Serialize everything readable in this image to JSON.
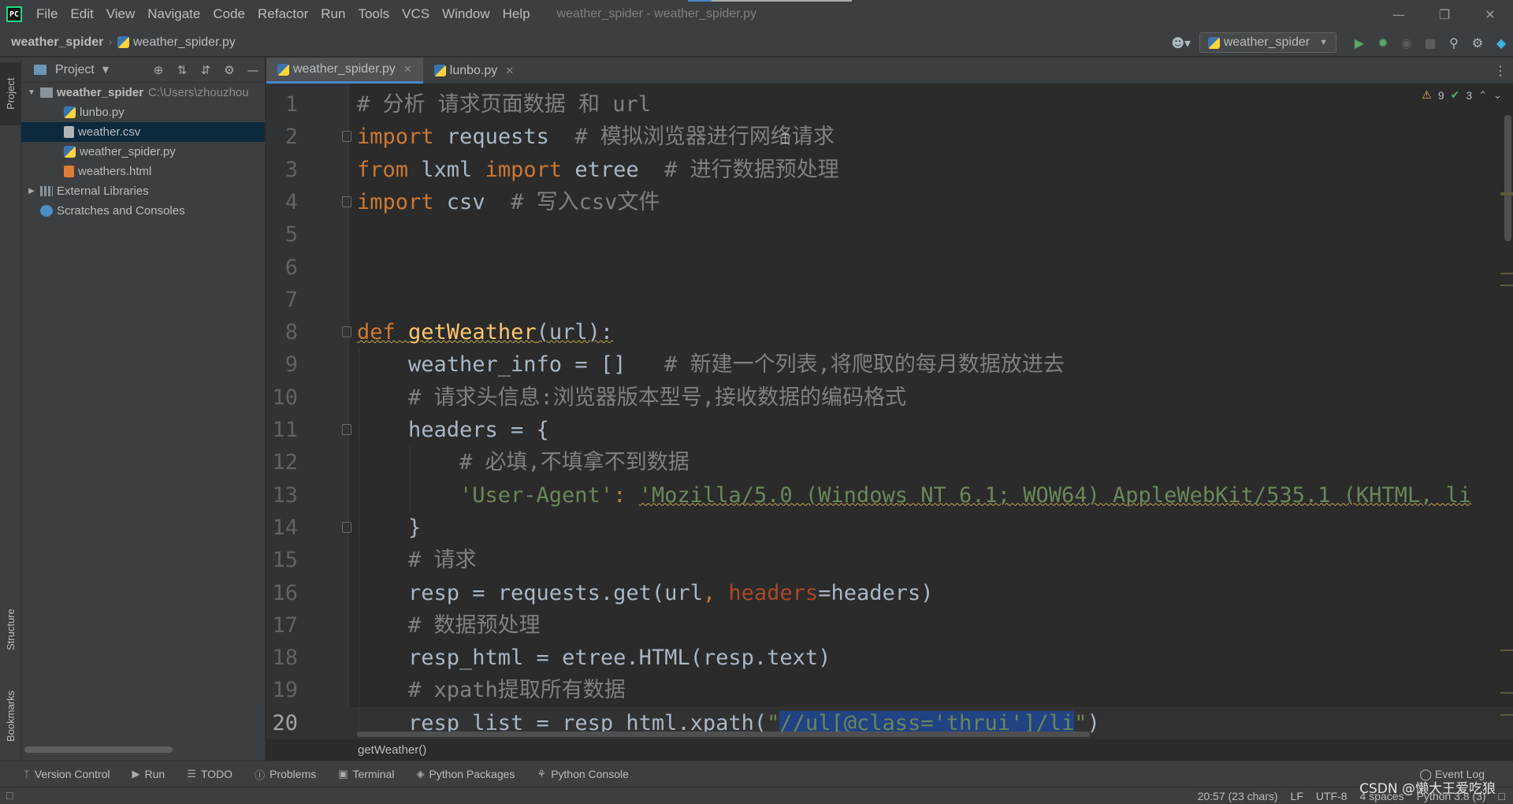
{
  "menu": [
    "File",
    "Edit",
    "View",
    "Navigate",
    "Code",
    "Refactor",
    "Run",
    "Tools",
    "VCS",
    "Window",
    "Help"
  ],
  "window_title": "weather_spider - weather_spider.py",
  "navbar": {
    "project": "weather_spider",
    "file": "weather_spider.py",
    "run_config": "weather_spider"
  },
  "stripe": {
    "project": "Project",
    "structure": "Structure",
    "bookmarks": "Bookmarks"
  },
  "project_panel": {
    "title": "Project",
    "root": "weather_spider",
    "root_path": "C:\\Users\\zhouzhou",
    "files": [
      {
        "name": "lunbo.py",
        "type": "py"
      },
      {
        "name": "weather.csv",
        "type": "csv"
      },
      {
        "name": "weather_spider.py",
        "type": "py"
      },
      {
        "name": "weathers.html",
        "type": "html"
      }
    ],
    "external": "External Libraries",
    "scratches": "Scratches and Consoles"
  },
  "tabs": [
    {
      "label": "weather_spider.py",
      "active": true
    },
    {
      "label": "lunbo.py",
      "active": false
    }
  ],
  "inspections": {
    "warnings": "9",
    "ok": "3"
  },
  "code": {
    "lines": [
      {
        "n": "1",
        "indent": 0,
        "parts": [
          {
            "c": "c",
            "t": "# 分析 请求页面数据 和 url"
          }
        ]
      },
      {
        "n": "2",
        "indent": 0,
        "fold": true,
        "parts": [
          {
            "c": "k",
            "t": "import"
          },
          {
            "c": "t",
            "t": " requests  "
          },
          {
            "c": "c",
            "t": "# 模拟浏览器进行网络请求"
          }
        ]
      },
      {
        "n": "3",
        "indent": 0,
        "parts": [
          {
            "c": "k",
            "t": "from"
          },
          {
            "c": "t",
            "t": " lxml "
          },
          {
            "c": "k",
            "t": "import"
          },
          {
            "c": "t",
            "t": " etree  "
          },
          {
            "c": "c",
            "t": "# 进行数据预处理"
          }
        ]
      },
      {
        "n": "4",
        "indent": 0,
        "fold": true,
        "parts": [
          {
            "c": "k",
            "t": "import"
          },
          {
            "c": "t",
            "t": " csv  "
          },
          {
            "c": "c",
            "t": "# 写入csv文件"
          }
        ]
      },
      {
        "n": "5",
        "indent": 0,
        "parts": []
      },
      {
        "n": "6",
        "indent": 0,
        "parts": []
      },
      {
        "n": "7",
        "indent": 0,
        "parts": []
      },
      {
        "n": "8",
        "indent": 0,
        "fold": true,
        "parts": [
          {
            "c": "k squig",
            "t": "def"
          },
          {
            "c": "f squig",
            "t": " getWeather"
          },
          {
            "c": "t squig",
            "t": "(url):"
          }
        ]
      },
      {
        "n": "9",
        "indent": 1,
        "parts": [
          {
            "c": "t",
            "t": "weather_info = []   "
          },
          {
            "c": "c",
            "t": "# 新建一个列表,将爬取的每月数据放进去"
          }
        ]
      },
      {
        "n": "10",
        "indent": 1,
        "parts": [
          {
            "c": "c",
            "t": "# 请求头信息:浏览器版本型号,接收数据的编码格式"
          }
        ]
      },
      {
        "n": "11",
        "indent": 1,
        "fold": true,
        "parts": [
          {
            "c": "t",
            "t": "headers = {"
          }
        ]
      },
      {
        "n": "12",
        "indent": 2,
        "parts": [
          {
            "c": "c",
            "t": "# 必填,不填拿不到数据"
          }
        ]
      },
      {
        "n": "13",
        "indent": 2,
        "parts": [
          {
            "c": "s",
            "t": "'User-Agent'"
          },
          {
            "c": "k",
            "t": ": "
          },
          {
            "c": "s squig",
            "t": "'Mozilla/5.0 (Windows NT 6.1; WOW64) AppleWebKit/535.1 (KHTML, li"
          }
        ]
      },
      {
        "n": "14",
        "indent": 1,
        "fold": true,
        "parts": [
          {
            "c": "t",
            "t": "}"
          }
        ]
      },
      {
        "n": "15",
        "indent": 1,
        "parts": [
          {
            "c": "c",
            "t": "# 请求"
          }
        ]
      },
      {
        "n": "16",
        "indent": 1,
        "parts": [
          {
            "c": "t",
            "t": "resp = requests.get(url"
          },
          {
            "c": "k",
            "t": ", "
          },
          {
            "c": "p",
            "t": "headers"
          },
          {
            "c": "t",
            "t": "=headers)"
          }
        ]
      },
      {
        "n": "17",
        "indent": 1,
        "parts": [
          {
            "c": "c",
            "t": "# 数据预处理"
          }
        ]
      },
      {
        "n": "18",
        "indent": 1,
        "parts": [
          {
            "c": "t",
            "t": "resp_html = etree.HTML(resp.text)"
          }
        ]
      },
      {
        "n": "19",
        "indent": 1,
        "parts": [
          {
            "c": "c",
            "t": "# xpath提取所有数据"
          }
        ]
      },
      {
        "n": "20",
        "indent": 1,
        "current": true,
        "parts": [
          {
            "c": "t",
            "t": "resp_list = resp_html.xpath("
          },
          {
            "c": "s",
            "t": "\""
          },
          {
            "c": "sel",
            "t": "//ul[@class='thrui']/li"
          },
          {
            "c": "s",
            "t": "\""
          },
          {
            "c": "t",
            "t": ")"
          }
        ]
      }
    ]
  },
  "code_breadcrumb": "getWeather()",
  "tool_windows": [
    "Version Control",
    "Run",
    "TODO",
    "Problems",
    "Terminal",
    "Python Packages",
    "Python Console"
  ],
  "event_log": "Event Log",
  "status": {
    "position": "20:57 (23 chars)",
    "line_sep": "LF",
    "encoding": "UTF-8",
    "indent": "4 spaces",
    "interpreter": "Python 3.8 (3)"
  },
  "watermark": "CSDN @懒大王爱吃狼"
}
